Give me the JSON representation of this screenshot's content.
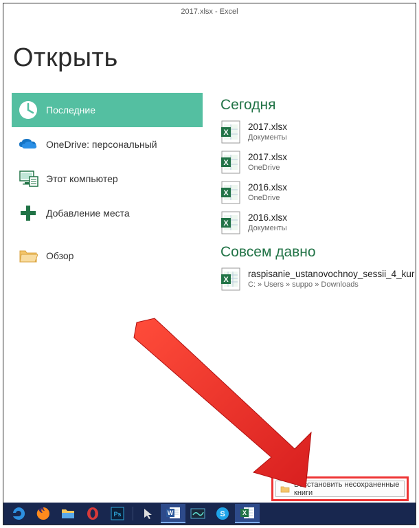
{
  "window": {
    "title": "2017.xlsx - Excel"
  },
  "page": {
    "heading": "Открыть"
  },
  "locations": {
    "recent": {
      "label": "Последние"
    },
    "onedrive": {
      "label": "OneDrive: персональный"
    },
    "thispc": {
      "label": "Этот компьютер"
    },
    "addplace": {
      "label": "Добавление места"
    },
    "browse": {
      "label": "Обзор"
    }
  },
  "sections": {
    "today": {
      "header": "Сегодня",
      "files": [
        {
          "name": "2017.xlsx",
          "path": "Документы"
        },
        {
          "name": "2017.xlsx",
          "path": "OneDrive"
        },
        {
          "name": "2016.xlsx",
          "path": "OneDrive"
        },
        {
          "name": "2016.xlsx",
          "path": "Документы"
        }
      ]
    },
    "older": {
      "header": "Совсем давно",
      "files": [
        {
          "name": "raspisanie_ustanovochnoy_sessii_4_kur",
          "path": "C: » Users » suppo » Downloads"
        }
      ]
    }
  },
  "recover": {
    "label": "Восстановить несохраненные книги"
  }
}
